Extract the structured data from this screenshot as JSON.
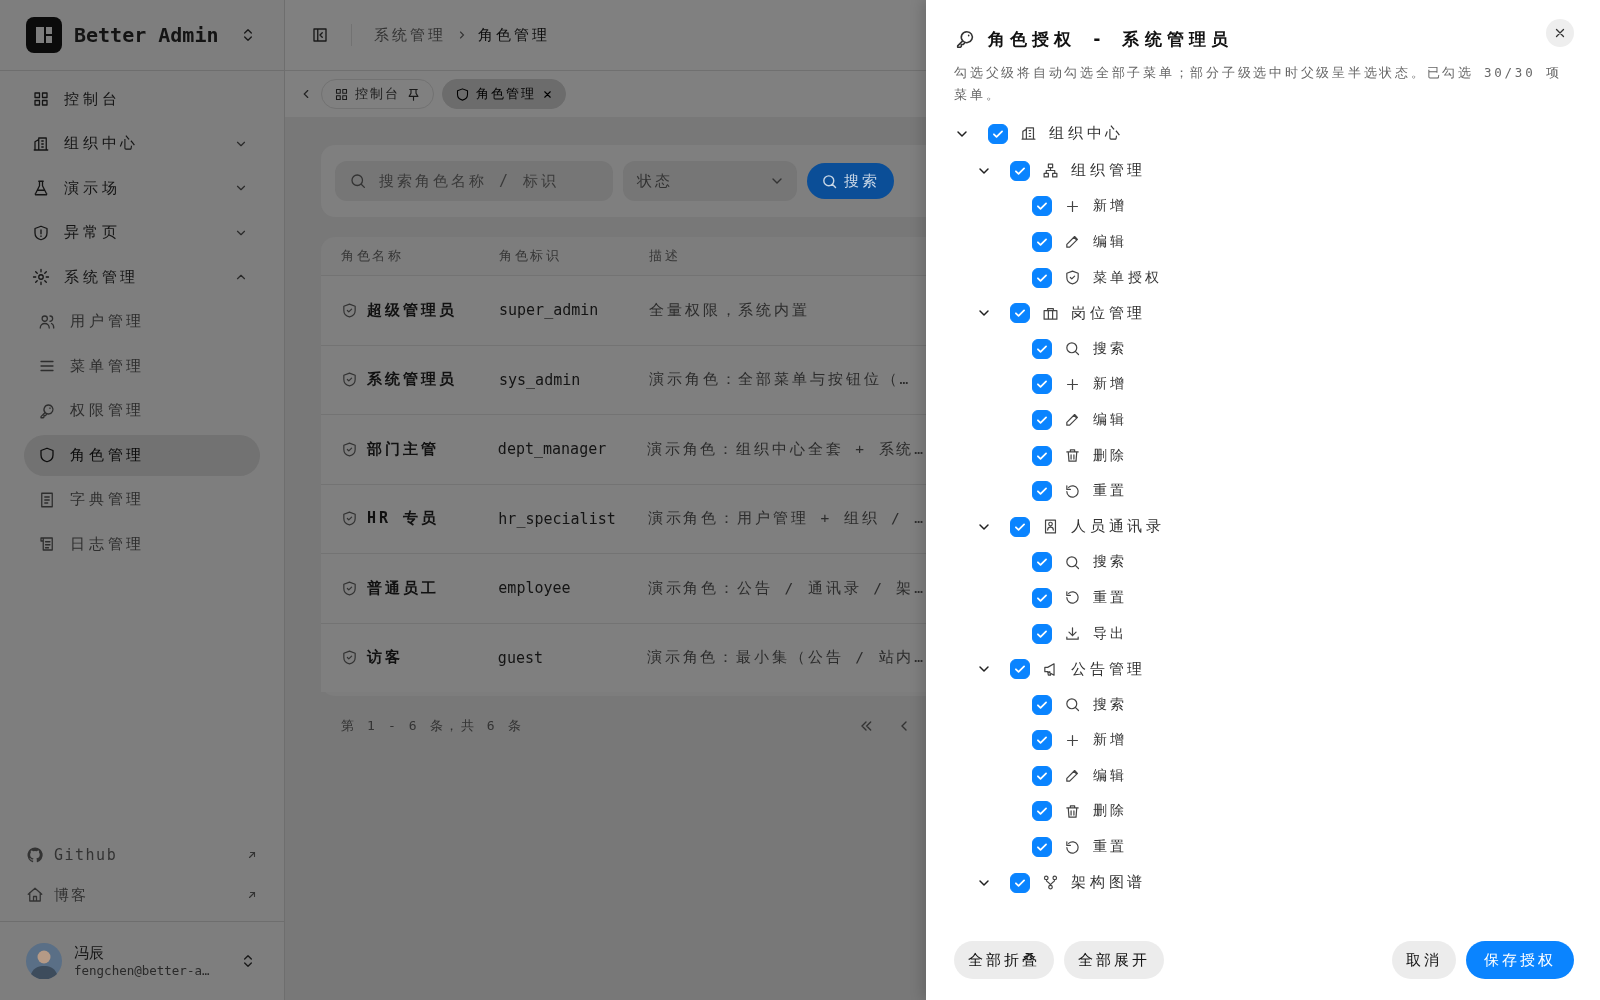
{
  "brand": {
    "name": "Better Admin"
  },
  "sidebar": {
    "items": [
      {
        "label": "控制台",
        "kind": "dashboard",
        "selected": false
      },
      {
        "label": "组织中心",
        "kind": "building",
        "selected": false,
        "expanded": false
      },
      {
        "label": "演示场",
        "kind": "flask",
        "selected": false,
        "expanded": false
      },
      {
        "label": "异常页",
        "kind": "alert",
        "selected": false,
        "expanded": false
      },
      {
        "label": "系统管理",
        "kind": "gear",
        "selected": false,
        "expanded": true,
        "children": [
          {
            "label": "用户管理",
            "kind": "users",
            "selected": false
          },
          {
            "label": "菜单管理",
            "kind": "menu",
            "selected": false
          },
          {
            "label": "权限管理",
            "kind": "key",
            "selected": false
          },
          {
            "label": "角色管理",
            "kind": "shield",
            "selected": true
          },
          {
            "label": "字典管理",
            "kind": "book",
            "selected": false
          },
          {
            "label": "日志管理",
            "kind": "log",
            "selected": false
          }
        ]
      }
    ],
    "links": [
      {
        "label": "Github",
        "kind": "github"
      },
      {
        "label": "博客",
        "kind": "home"
      }
    ],
    "user": {
      "name": "冯辰",
      "email": "fengchen@better-a…"
    }
  },
  "breadcrumb": [
    "系统管理",
    "角色管理"
  ],
  "tabs": [
    {
      "label": "控制台",
      "kind": "dashboard",
      "selected": false,
      "pinned": true,
      "closable": false
    },
    {
      "label": "角色管理",
      "kind": "shield",
      "selected": true,
      "pinned": false,
      "closable": true
    }
  ],
  "filters": {
    "search_placeholder": "搜索角色名称 / 标识",
    "status_placeholder": "状态",
    "search_button": "搜索"
  },
  "table": {
    "columns": [
      "角色名称",
      "角色标识",
      "描述"
    ],
    "rows": [
      {
        "name": "超级管理员",
        "code": "super_admin",
        "description": "全量权限，系统内置"
      },
      {
        "name": "系统管理员",
        "code": "sys_admin",
        "description": "演示角色：全部菜单与按钮位（…"
      },
      {
        "name": "部门主管",
        "code": "dept_manager",
        "description": "演示角色：组织中心全套 + 系统…"
      },
      {
        "name": "HR 专员",
        "code": "hr_specialist",
        "description": "演示角色：用户管理 + 组织 / …"
      },
      {
        "name": "普通员工",
        "code": "employee",
        "description": "演示角色：公告 / 通讯录 / 架…"
      },
      {
        "name": "访客",
        "code": "guest",
        "description": "演示角色：最小集（公告 / 站内…"
      }
    ]
  },
  "pagination": {
    "summary": "第 1 - 6 条，共 6 条"
  },
  "drawer": {
    "title": "角色授权 - 系统管理员",
    "description": "勾选父级将自动勾选全部子菜单；部分子级选中时父级呈半选状态。已勾选 30/30 项菜单。",
    "tree": [
      {
        "label": "组织中心",
        "kind": "building",
        "checked": true,
        "expanded": true,
        "children": [
          {
            "label": "组织管理",
            "kind": "hierarchy",
            "checked": true,
            "expanded": true,
            "children": [
              {
                "label": "新增",
                "kind": "add",
                "checked": true
              },
              {
                "label": "编辑",
                "kind": "edit",
                "checked": true
              },
              {
                "label": "菜单授权",
                "kind": "authorize",
                "checked": true
              }
            ]
          },
          {
            "label": "岗位管理",
            "kind": "briefcase",
            "checked": true,
            "expanded": true,
            "children": [
              {
                "label": "搜索",
                "kind": "search",
                "checked": true
              },
              {
                "label": "新增",
                "kind": "add",
                "checked": true
              },
              {
                "label": "编辑",
                "kind": "edit",
                "checked": true
              },
              {
                "label": "删除",
                "kind": "delete",
                "checked": true
              },
              {
                "label": "重置",
                "kind": "reset",
                "checked": true
              }
            ]
          },
          {
            "label": "人员通讯录",
            "kind": "contacts",
            "checked": true,
            "expanded": true,
            "children": [
              {
                "label": "搜索",
                "kind": "search",
                "checked": true
              },
              {
                "label": "重置",
                "kind": "reset",
                "checked": true
              },
              {
                "label": "导出",
                "kind": "export",
                "checked": true
              }
            ]
          },
          {
            "label": "公告管理",
            "kind": "megaphone",
            "checked": true,
            "expanded": true,
            "children": [
              {
                "label": "搜索",
                "kind": "search",
                "checked": true
              },
              {
                "label": "新增",
                "kind": "add",
                "checked": true
              },
              {
                "label": "编辑",
                "kind": "edit",
                "checked": true
              },
              {
                "label": "删除",
                "kind": "delete",
                "checked": true
              },
              {
                "label": "重置",
                "kind": "reset",
                "checked": true
              }
            ]
          },
          {
            "label": "架构图谱",
            "kind": "graph",
            "checked": true,
            "expanded": true
          }
        ]
      }
    ],
    "tree_buttons": [
      "全部折叠",
      "全部展开"
    ],
    "actions": [
      {
        "label": "取消",
        "kind": "secondary"
      },
      {
        "label": "保存授权",
        "kind": "primary"
      }
    ]
  }
}
